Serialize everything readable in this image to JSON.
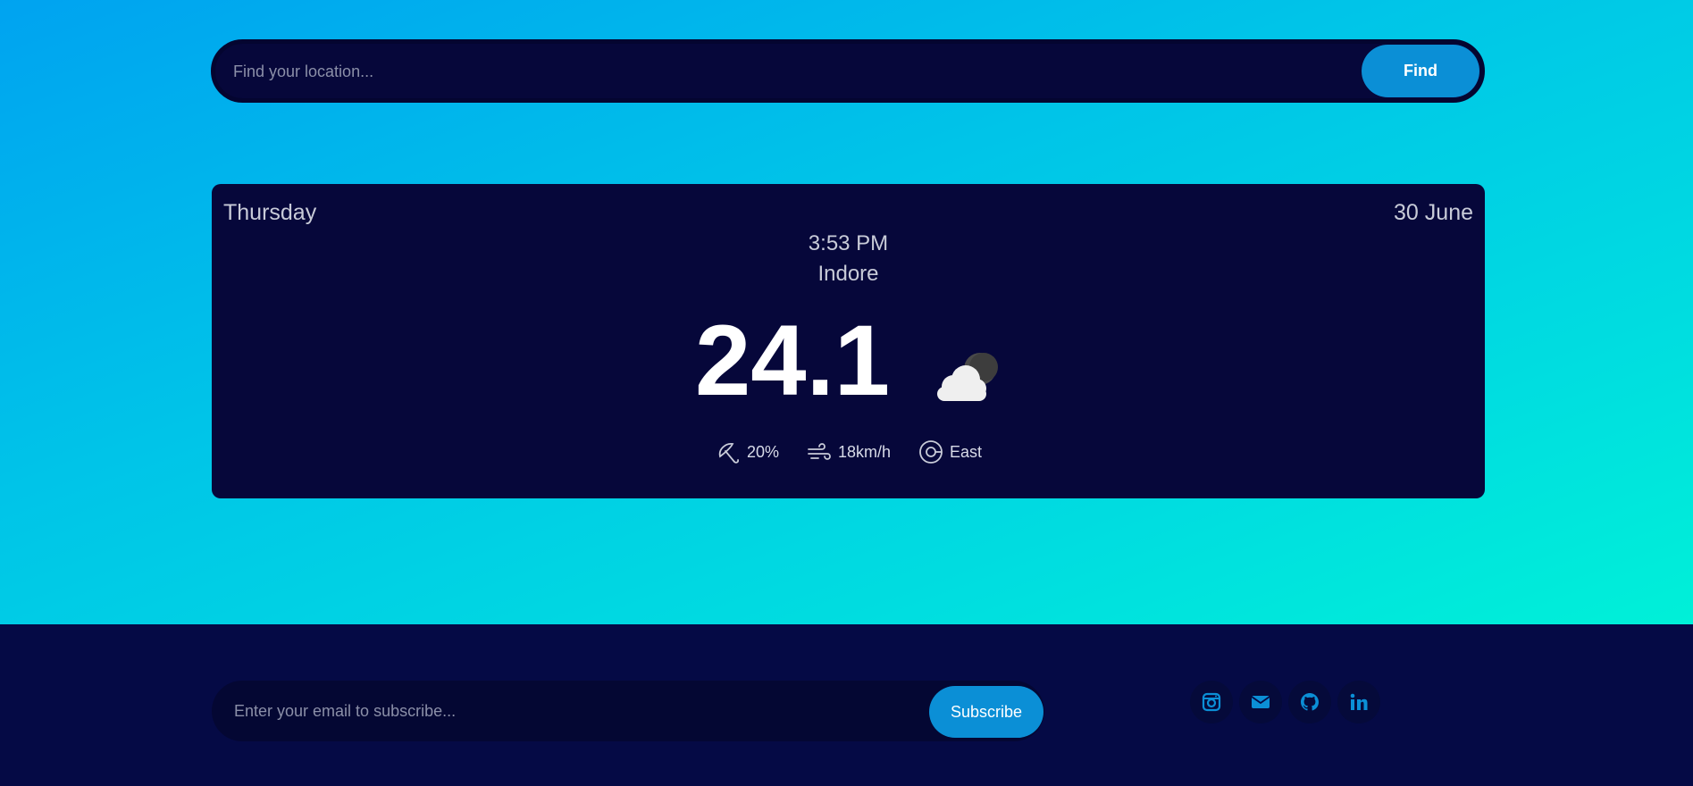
{
  "search": {
    "placeholder": "Find your location...",
    "button_label": "Find"
  },
  "weather": {
    "day": "Thursday",
    "date": "30 June",
    "time": "3:53 PM",
    "city": "Indore",
    "temperature": "24.1",
    "condition_icon": "cloud-moon-icon",
    "stats": {
      "precipitation": "20%",
      "wind_speed": "18km/h",
      "wind_direction": "East"
    }
  },
  "footer": {
    "email_placeholder": "Enter your email to subscribe...",
    "subscribe_label": "Subscribe",
    "socials": [
      "instagram-icon",
      "email-icon",
      "github-icon",
      "linkedin-icon"
    ]
  },
  "colors": {
    "accent": "#0b8fd6",
    "card_bg": "#06073a",
    "footer_bg": "#050a45",
    "gradient_start": "#00a3f0",
    "gradient_end": "#00f0d8"
  }
}
